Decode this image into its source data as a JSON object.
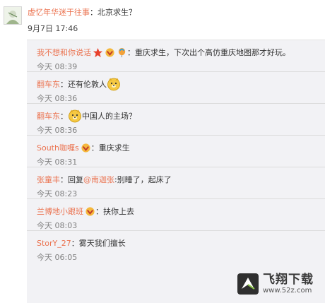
{
  "parent": {
    "user": "虚忆年华迷于往事",
    "text": "：北京求生？",
    "time": "9月7日 17:46"
  },
  "replies": [
    {
      "user": "我不想和你说话",
      "text": "：重庆求生，下次出个高仿重庆地图那才好玩。",
      "time": "今天 08:39",
      "badges": [
        "star-badge-icon",
        "vip-badge-icon",
        "balloon-badge-icon"
      ]
    },
    {
      "user": "翻车东",
      "text": "：还有伦敦人",
      "time": "今天 08:36",
      "emoji": "doge-emoji-icon"
    },
    {
      "user": "翻车东",
      "pre": "：",
      "text": "中国人的主场？",
      "time": "今天 08:36",
      "emoji": "doge-emoji-icon"
    },
    {
      "user": "South咖喱s",
      "text": "：重庆求生",
      "time": "今天 08:31",
      "badges": [
        "vip-badge-icon"
      ]
    },
    {
      "user": "张童丰",
      "pre": "：回复",
      "mention": "@南迦张",
      "text": ":别睡了，起床了",
      "time": "今天 08:23"
    },
    {
      "user": "兰博地小跟班",
      "text": "：扶你上去",
      "time": "今天 08:03",
      "badges": [
        "vip-badge-icon"
      ]
    },
    {
      "user": "StorY_27",
      "text": "：雾天我们擅长",
      "time": "今天 06:05"
    }
  ],
  "watermark": {
    "title": "飞翔下载",
    "url": "www.52z.com"
  },
  "colors": {
    "username": "#eb7350",
    "thread_bg": "#f2f2f5",
    "time": "#808080"
  }
}
